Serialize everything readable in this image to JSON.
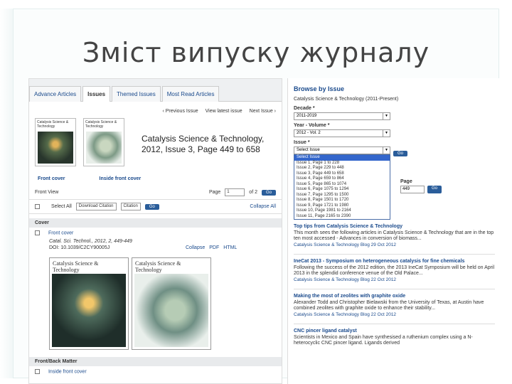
{
  "slide": {
    "title": "Зміст випуску журналу",
    "colors": {
      "title": "#444444",
      "link": "#1a4a8c",
      "go_button": "#2a5d9a",
      "highlight": "#3366cc"
    }
  },
  "left": {
    "tabs": [
      "Advance Articles",
      "Issues",
      "Themed Issues",
      "Most Read Articles"
    ],
    "active_tab": "Issues",
    "issue_nav": {
      "previous": "‹ Previous Issue",
      "view_latest": "View latest issue",
      "next": "Next Issue ›"
    },
    "cover_small": {
      "journal": "Catalysis Science & Technology"
    },
    "issue_title": "Catalysis Science & Technology, 2012, Issue 3, Page 449 to 658",
    "cover_links": {
      "front": "Front cover",
      "inside": "Inside front cover"
    },
    "toolbar": {
      "front_view": "Front View",
      "page_label": "Page",
      "page_value": "1",
      "page_of": "of 2",
      "go": "Go",
      "select_all": "Select All",
      "download_citation": "Download Citation",
      "format": "Citation",
      "go2": "Go",
      "collapse_all": "Collapse All"
    },
    "section_cover": "Cover",
    "article": {
      "title": "Front cover",
      "ref": "Catal. Sci. Technol., 2012, 2, 449-449",
      "doi": "DOI: 10.1039/C2CY90005J",
      "collapse": "Collapse",
      "pdf": "PDF",
      "html": "HTML"
    },
    "big_cover": {
      "journal": "Catalysis Science & Technology"
    },
    "section_front_back": "Front/Back Matter",
    "article2_title": "Inside front cover"
  },
  "right": {
    "browse_title": "Browse by Issue",
    "journal": "Catalysis Science & Technology (2011-Present)",
    "decade_label": "Decade *",
    "decade_value": "2011-2019",
    "year_label": "Year - Volume *",
    "year_value": "2012 - Vol. 2",
    "issue_label": "Issue *",
    "issue_value": "Select Issue",
    "go": "Go",
    "issue_options": [
      "Select Issue",
      "Issue 1, Page 1 to 228",
      "Issue 2, Page 229 to 448",
      "Issue 3, Page 449 to 658",
      "Issue 4, Page 659 to 864",
      "Issue 5, Page 865 to 1074",
      "Issue 6, Page 1075 to 1294",
      "Issue 7, Page 1295 to 1500",
      "Issue 8, Page 1501 to 1720",
      "Issue 9, Page 1721 to 1980",
      "Issue 10, Page 1981 to 2164",
      "Issue 11, Page 2165 to 2390"
    ],
    "highlighted_option": 0,
    "page_label": "Page",
    "page_value": "449",
    "go2": "Go",
    "news": [
      {
        "headline": "Top tips from Catalysis Science & Technology",
        "body": "This month sees the following articles in Catalysis Science & Technology that are in the top ten most accessed - Advances in conversion of biomass...",
        "source": "Catalysis Science & Technology Blog 29 Oct 2012"
      },
      {
        "headline": "IneCat 2013 - Symposium on heterogeneous catalysis for fine chemicals",
        "body": "Following the success of the 2012 edition, the 2013 IneCat Symposium will be held on April 2013 in the splendid conference venue of the Old Palace...",
        "source": "Catalysis Science & Technology Blog 22 Oct 2012"
      },
      {
        "headline": "Making the most of zeolites with graphite oxide",
        "body": "Alexander Todd and Christopher Bielawski from the University of Texas, at Austin have combined zeolites with graphite oxide to enhance their stability...",
        "source": "Catalysis Science & Technology Blog 22 Oct 2012"
      },
      {
        "headline": "CNC pincer ligand catalyst",
        "body": "Scientists in Mexico and Spain have synthesised a ruthenium complex using a N-heterocyclic CNC pincer ligand. Ligands derived",
        "source": ""
      }
    ]
  }
}
